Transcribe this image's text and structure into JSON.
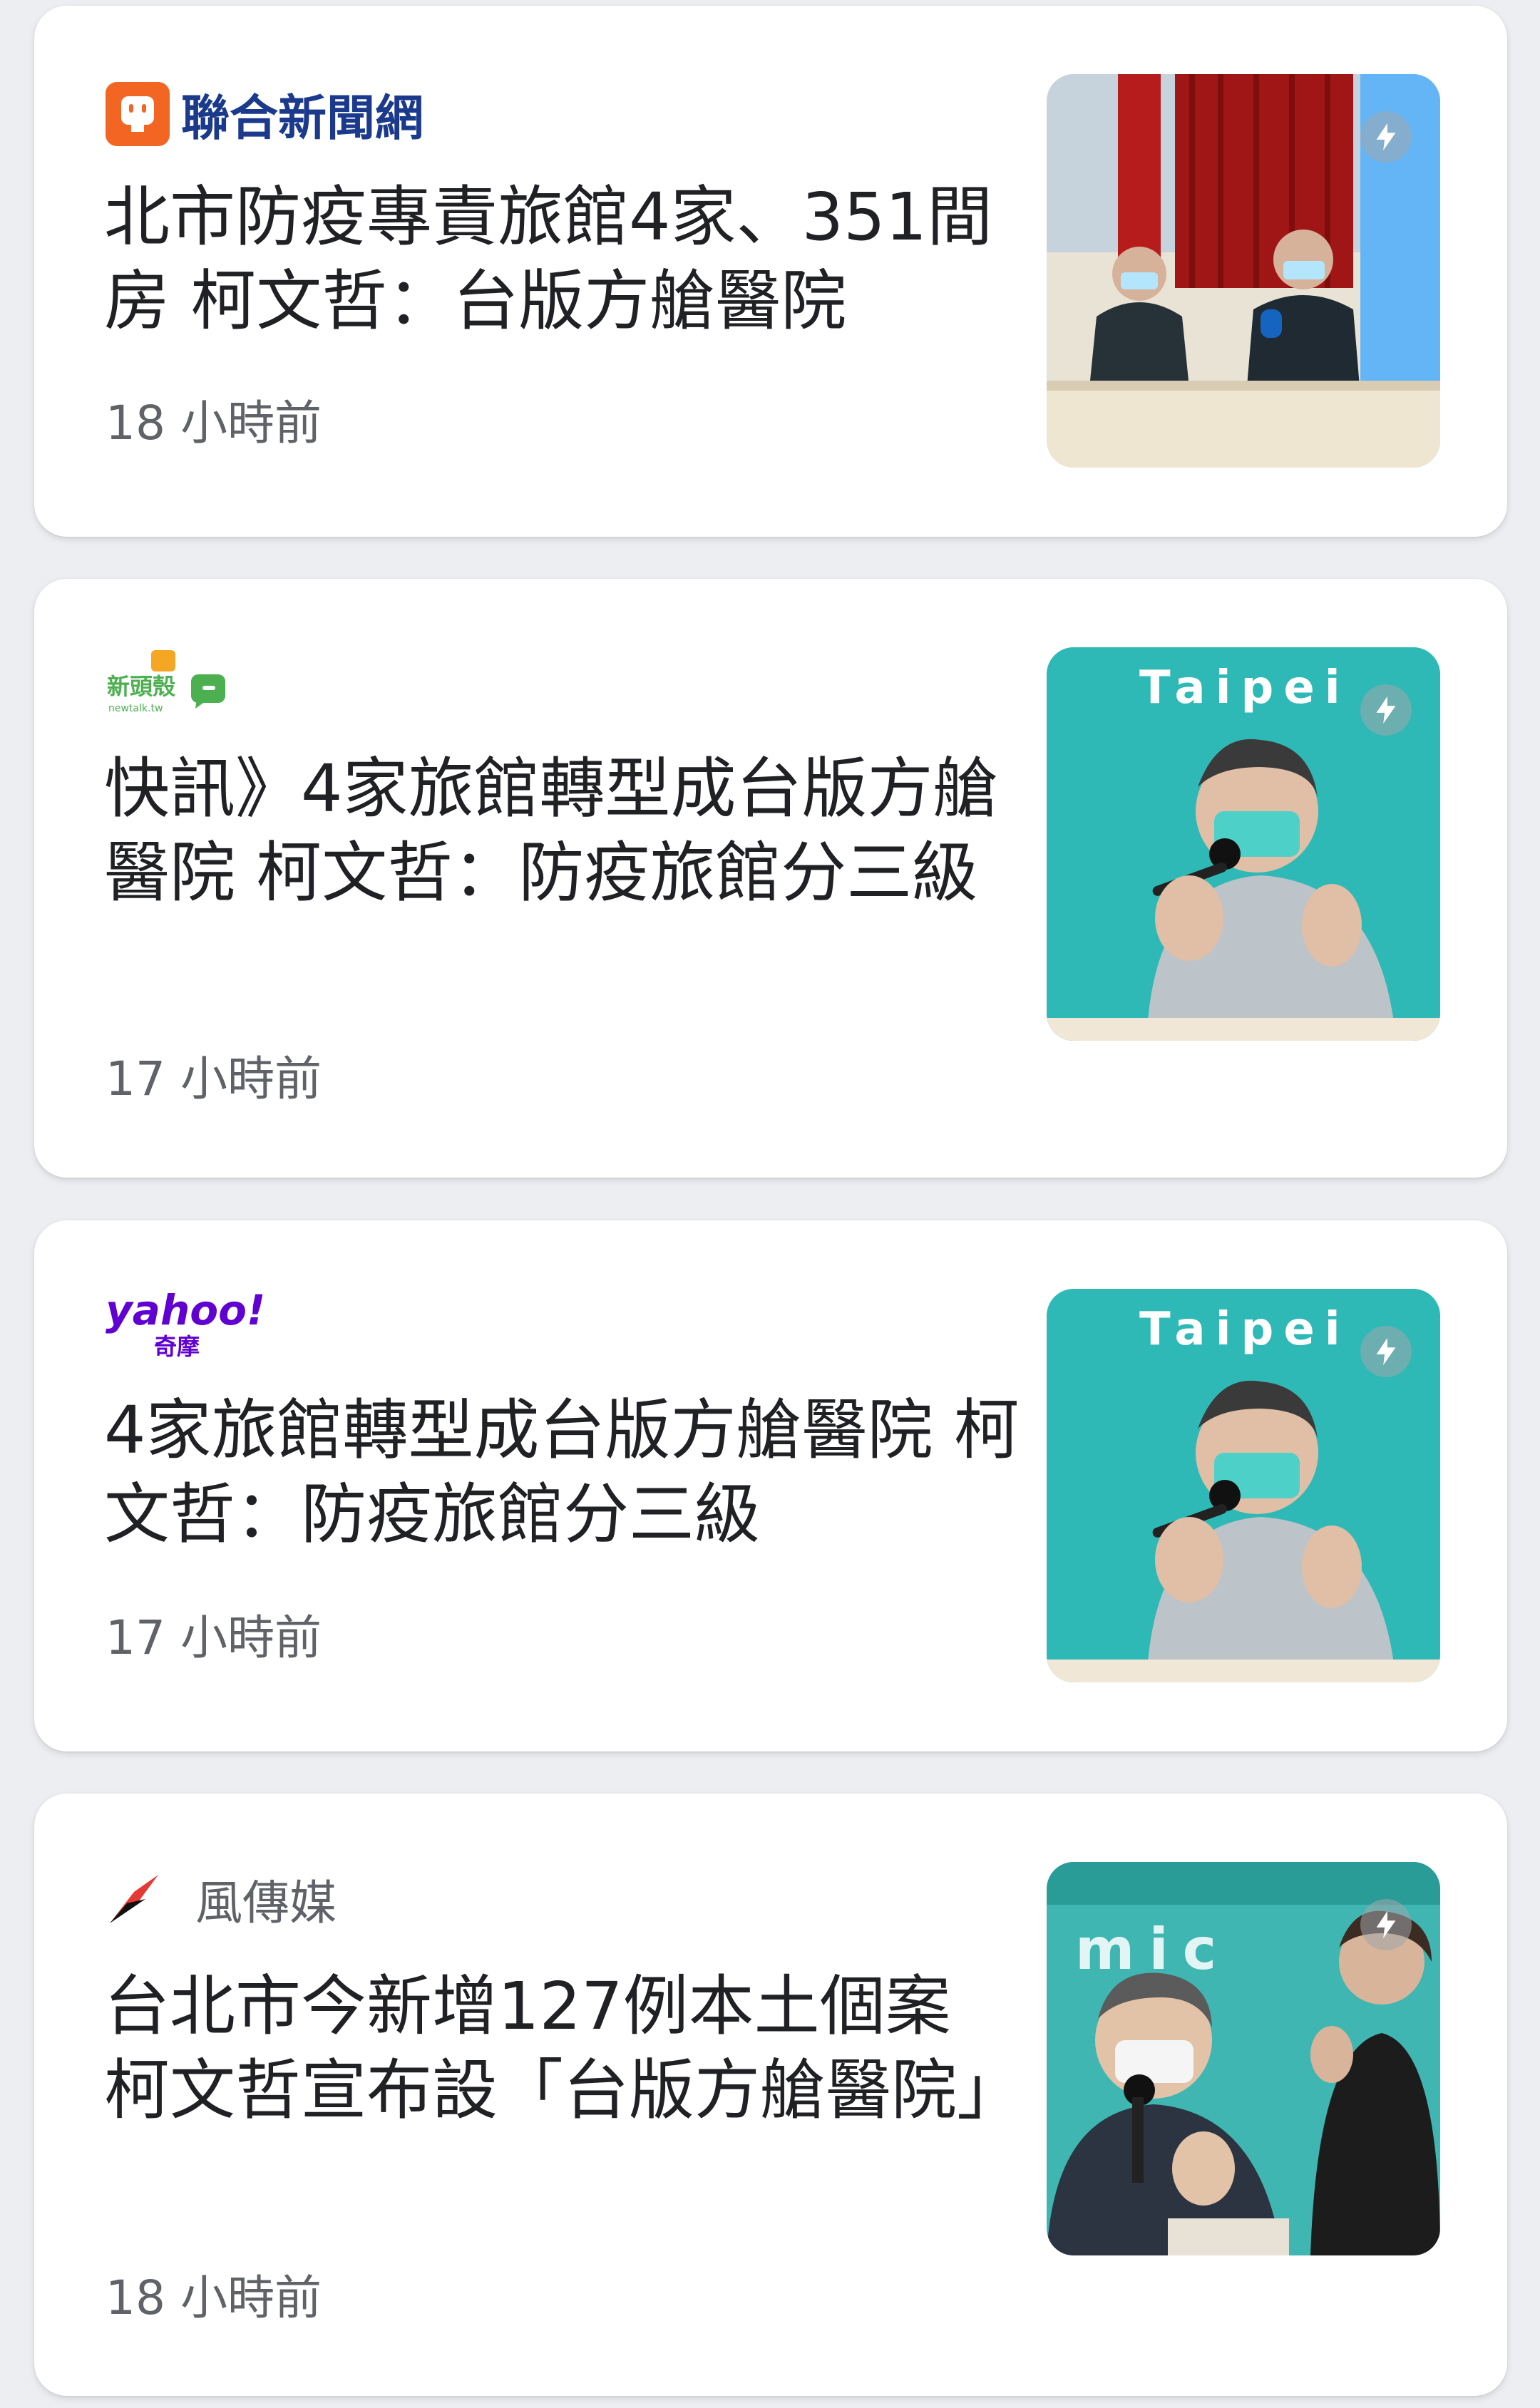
{
  "colors": {
    "udn_orange": "#f26522",
    "udn_blue": "#1b3a8c",
    "newtalk_green": "#4caf50",
    "yahoo_purple": "#6001d2",
    "storm_red": "#e53935",
    "headline_text": "#202124",
    "meta_text": "#5f6368"
  },
  "articles": [
    {
      "source": "聯合新聞網",
      "source_logo_icon": "udn-logo-icon",
      "title": "北市防疫專責旅館4家、351間房 柯文哲：台版方艙醫院",
      "time": "18 小時前",
      "thumbnail": "press-conference-photo",
      "badge_icon": "amp-lightning-icon"
    },
    {
      "source": "",
      "source_logo_icon": "newtalk-logo-icon",
      "source_logo_text": "新頭殼",
      "source_logo_sub": "newtalk.tw",
      "title": "快訊》4家旅館轉型成台版方艙醫院 柯文哲：防疫旅館分三級",
      "time": "17 小時前",
      "thumbnail": "speaker-with-microphone-photo",
      "thumbnail_text": "Taipei",
      "badge_icon": "amp-lightning-icon"
    },
    {
      "source": "",
      "source_logo_icon": "yahoo-logo-icon",
      "source_logo_text": "yahoo!",
      "source_logo_sub": "奇摩",
      "title": "4家旅館轉型成台版方艙醫院 柯文哲：防疫旅館分三級",
      "time": "17 小時前",
      "thumbnail": "speaker-with-microphone-photo",
      "thumbnail_text": "Taipei",
      "badge_icon": "amp-lightning-icon"
    },
    {
      "source": "風傳媒",
      "source_logo_icon": "storm-media-logo-icon",
      "title": "台北市今新增127例本土個案 柯文哲宣布設「台版方艙醫院」",
      "time": "18 小時前",
      "thumbnail": "speaker-and-sign-interpreter-photo",
      "thumbnail_text": "mic",
      "badge_icon": "amp-lightning-icon"
    }
  ]
}
